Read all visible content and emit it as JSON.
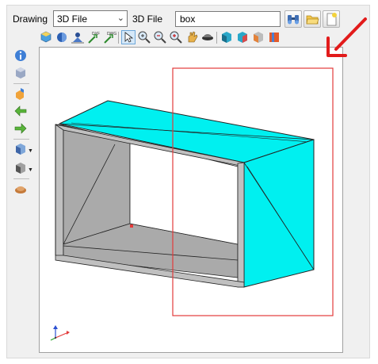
{
  "header": {
    "drawing_label": "Drawing",
    "drawing_type_value": "3D File",
    "file_label": "3D File",
    "file_value": "box"
  },
  "icons": {
    "browse": "binoculars-icon",
    "open": "folder-open-icon",
    "new": "new-file-icon"
  },
  "colors": {
    "face": "#00f0f0",
    "interior": "#aaaaaa",
    "frame": "#c0c0c0",
    "highlight": "#e33b3b",
    "arrow": "#e21b1b"
  }
}
